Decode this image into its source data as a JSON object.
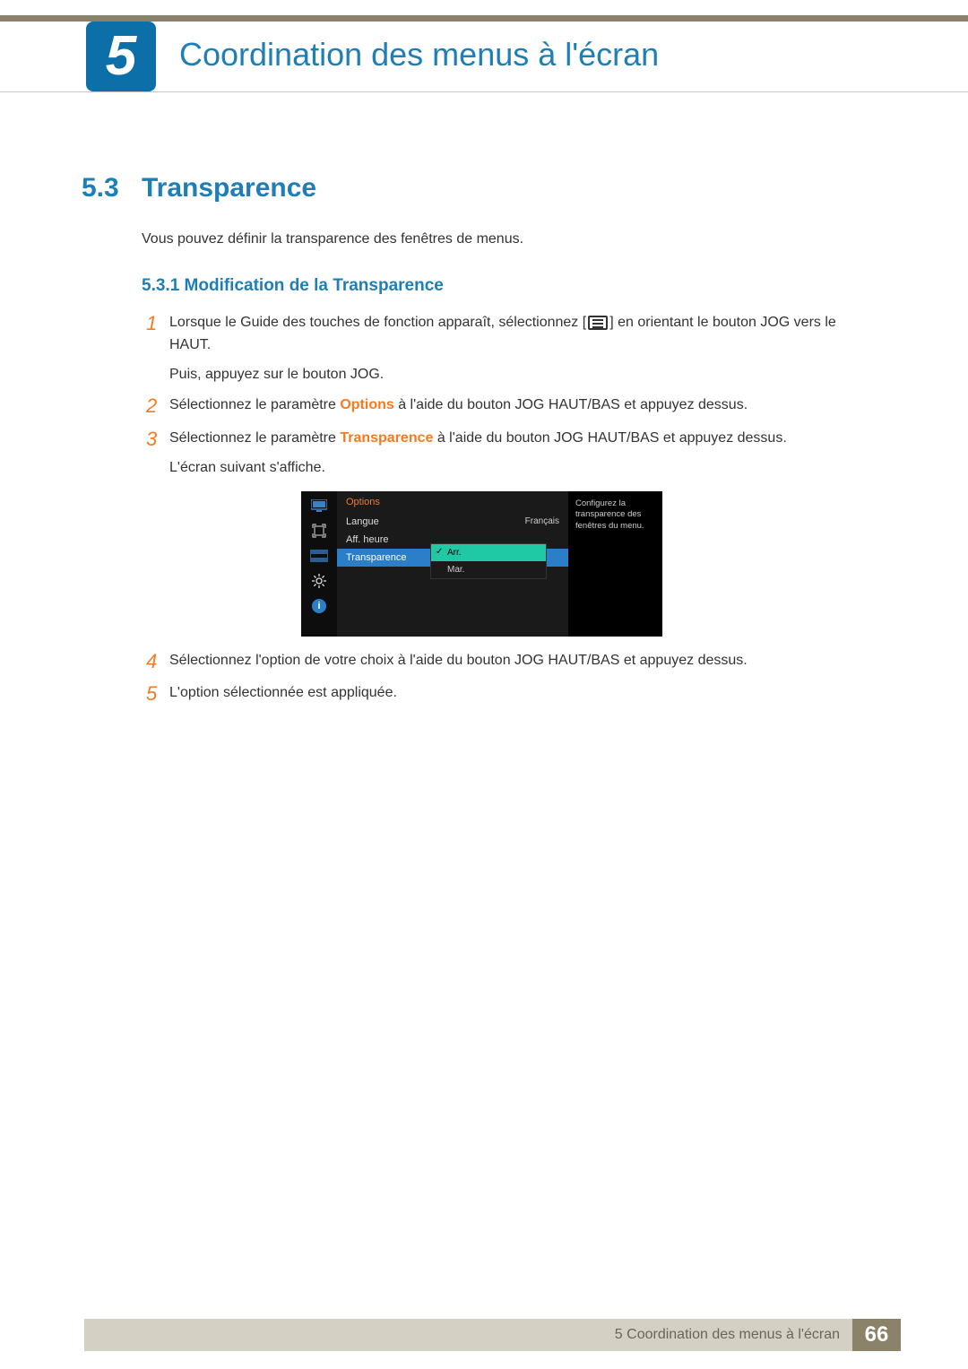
{
  "chapter": {
    "number": "5",
    "title": "Coordination des menus à l'écran"
  },
  "section": {
    "number": "5.3",
    "title": "Transparence",
    "intro": "Vous pouvez définir la transparence des fenêtres de menus."
  },
  "subsection": {
    "number": "5.3.1",
    "title": "Modification de la Transparence",
    "label": "5.3.1   Modification de la Transparence"
  },
  "steps": {
    "s1": {
      "num": "1",
      "pre": "Lorsque le Guide des touches de fonction apparaît, sélectionnez [",
      "post": "] en orientant le bouton JOG vers le HAUT.",
      "extra": "Puis, appuyez sur le bouton JOG."
    },
    "s2": {
      "num": "2",
      "pre": "Sélectionnez le paramètre ",
      "hi": "Options",
      "post": " à l'aide du bouton JOG HAUT/BAS et appuyez dessus."
    },
    "s3": {
      "num": "3",
      "pre": "Sélectionnez le paramètre ",
      "hi": "Transparence",
      "post": " à l'aide du bouton JOG HAUT/BAS et appuyez dessus.",
      "extra": "L'écran suivant s'affiche."
    },
    "s4": {
      "num": "4",
      "text": "Sélectionnez l'option de votre choix à l'aide du bouton JOG HAUT/BAS et appuyez dessus."
    },
    "s5": {
      "num": "5",
      "text": "L'option sélectionnée est appliquée."
    }
  },
  "osd": {
    "head": "Options",
    "langue_label": "Langue",
    "langue_value": "Français",
    "aff_label": "Aff. heure",
    "transparence_label": "Transparence",
    "opt_on": "Arr.",
    "opt_off": "Mar.",
    "help": "Configurez la transparence des fenêtres du menu.",
    "info_icon": "i"
  },
  "footer": {
    "text": "5 Coordination des menus à l'écran",
    "page": "66"
  }
}
